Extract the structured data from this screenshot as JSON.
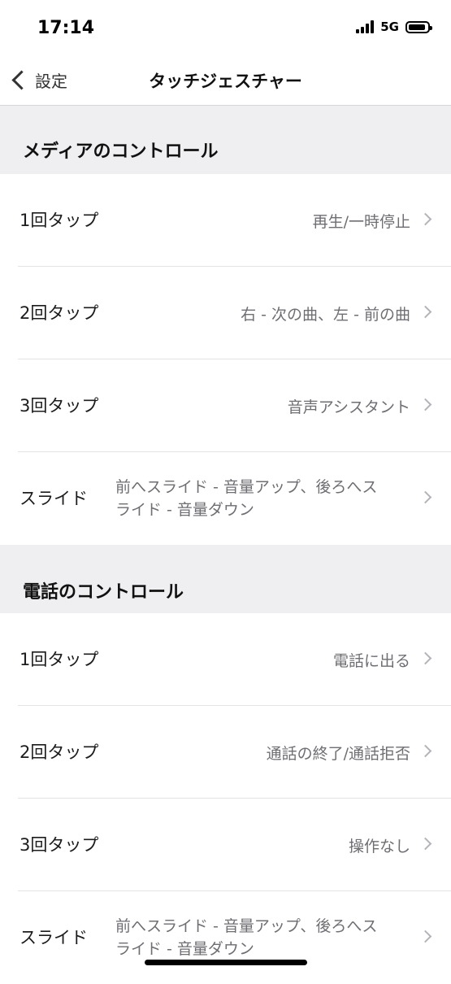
{
  "status_bar": {
    "time": "17:14",
    "network": "5G",
    "battery_level": 0.9
  },
  "nav": {
    "back_label": "設定",
    "title": "タッチジェスチャー"
  },
  "media_section": {
    "title": "メディアのコントロール",
    "rows": [
      {
        "label": "1回タップ",
        "value": "再生/一時停止"
      },
      {
        "label": "2回タップ",
        "value": "右 - 次の曲、左 - 前の曲"
      },
      {
        "label": "3回タップ",
        "value": "音声アシスタント"
      },
      {
        "label": "スライド",
        "value_line1": "前へスライド - 音量アップ、後ろへス",
        "value_line2": "ライド - 音量ダウン"
      }
    ]
  },
  "call_section": {
    "title": "電話のコントロール",
    "rows": [
      {
        "label": "1回タップ",
        "value": "電話に出る"
      },
      {
        "label": "2回タップ",
        "value": "通話の終了/通話拒否"
      },
      {
        "label": "3回タップ",
        "value": "操作なし"
      },
      {
        "label": "スライド",
        "value_line1": "前へスライド - 音量アップ、後ろへス",
        "value_line2": "ライド - 音量ダウン"
      }
    ]
  }
}
